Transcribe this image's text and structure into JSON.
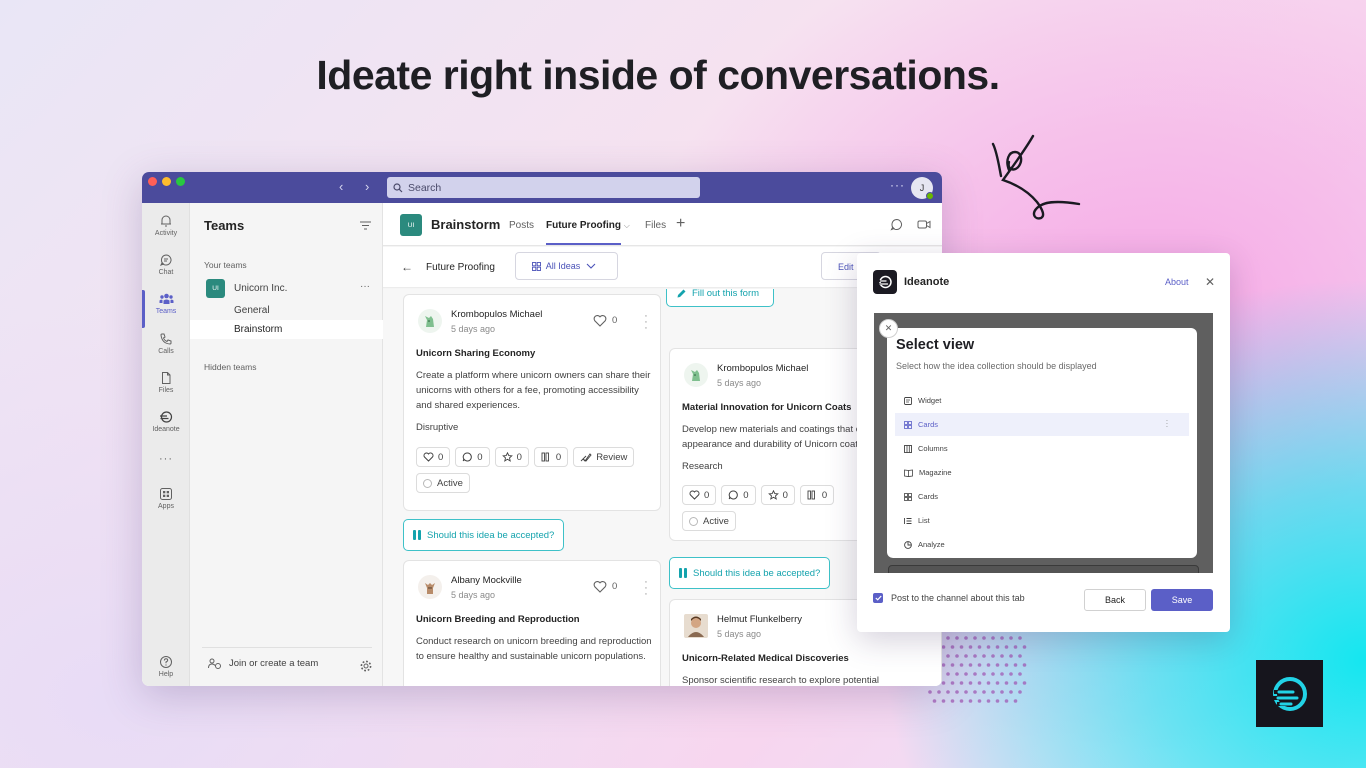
{
  "headline": "Ideate right inside of conversations.",
  "colors": {
    "teams_purple": "#4b4b9c",
    "accent": "#5b5fc7",
    "teal": "#14a3ad",
    "team_badge": "#2b8a7e"
  },
  "titlebar": {
    "search_placeholder": "Search",
    "more": "···",
    "avatar_initial": "J"
  },
  "rail": [
    {
      "label": "Activity",
      "icon": "bell-icon"
    },
    {
      "label": "Chat",
      "icon": "chat-icon"
    },
    {
      "label": "Teams",
      "icon": "teams-icon"
    },
    {
      "label": "Calls",
      "icon": "phone-icon"
    },
    {
      "label": "Files",
      "icon": "file-icon"
    },
    {
      "label": "Ideanote",
      "icon": "ideanote-icon"
    },
    {
      "label": "···",
      "icon": "more-icon"
    },
    {
      "label": "Apps",
      "icon": "apps-icon"
    },
    {
      "label": "Help",
      "icon": "help-icon"
    }
  ],
  "teams_panel": {
    "title": "Teams",
    "your_teams": "Your teams",
    "team": {
      "initials": "UI",
      "name": "Unicorn Inc.",
      "more": "···"
    },
    "channels": [
      "General",
      "Brainstorm"
    ],
    "hidden_teams": "Hidden teams",
    "join": "Join or create a team"
  },
  "channel": {
    "initials": "UI",
    "name": "Brainstorm",
    "tabs": [
      "Posts",
      "Future Proofing",
      "Files"
    ],
    "plus": "+"
  },
  "subbar": {
    "back": "←",
    "title": "Future Proofing",
    "filter": "All Ideas",
    "edit": "Edit"
  },
  "fill_form": "Fill out this form",
  "question": "Should this idea be accepted?",
  "ideas": [
    {
      "author": "Krombopulos Michael",
      "time": "5 days ago",
      "likes": "0",
      "title": "Unicorn Sharing Economy",
      "description": "Create a platform where unicorn owners can share their unicorns with others for a fee, promoting accessibility and shared experiences.",
      "category": "Disruptive",
      "counts": {
        "likes": "0",
        "comments": "0",
        "stars": "0",
        "votes": "0"
      },
      "review": "Review",
      "status": "Active"
    },
    {
      "author": "Albany Mockville",
      "time": "5 days ago",
      "likes": "0",
      "title": "Unicorn Breeding and Reproduction",
      "description": "Conduct research on unicorn breeding and reproduction to ensure healthy and sustainable unicorn populations."
    },
    {
      "author": "Krombopulos Michael",
      "time": "5 days ago",
      "title": "Material Innovation for Unicorn Coats",
      "description": "Develop new materials and coatings that enhance the appearance and durability of Unicorn coats.",
      "category": "Research",
      "counts": {
        "likes": "0",
        "comments": "0",
        "stars": "0",
        "votes": "0"
      },
      "status": "Active"
    },
    {
      "author": "Helmut Flunkelberry",
      "time": "5 days ago",
      "title": "Unicorn-Related Medical Discoveries",
      "description": "Sponsor scientific research to explore potential"
    }
  ],
  "dialog": {
    "title": "Ideanote",
    "about": "About",
    "close": "✕",
    "select_view": {
      "title": "Select view",
      "subtitle": "Select how the idea collection should be displayed",
      "options": [
        "Widget",
        "Cards",
        "Columns",
        "Magazine",
        "Cards",
        "List",
        "Analyze"
      ],
      "selected": "Cards"
    },
    "checkbox_label": "Post to the channel about this tab",
    "back": "Back",
    "save": "Save"
  }
}
